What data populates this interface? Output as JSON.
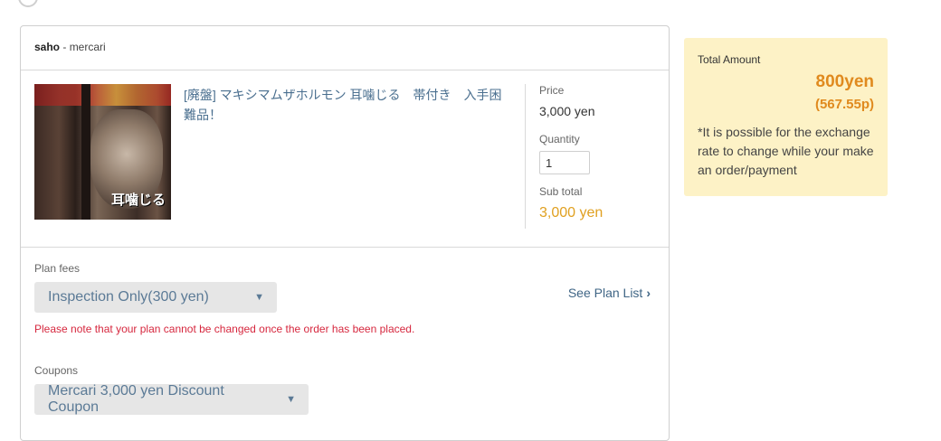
{
  "order": {
    "seller_name": "saho",
    "seller_separator": " - ",
    "seller_platform": "mercari"
  },
  "item": {
    "title": "[廃盤] マキシマムザホルモン 耳噛じる　帯付き　入手困難品！",
    "thumbnail_text": "耳噛じる",
    "price_label": "Price",
    "price_value": "3,000 yen",
    "quantity_label": "Quantity",
    "quantity_value": "1",
    "subtotal_label": "Sub total",
    "subtotal_value": "3,000 yen"
  },
  "plan": {
    "label": "Plan fees",
    "selected": "Inspection Only(300 yen)",
    "see_plan_link": "See Plan List",
    "note": "Please note that your plan cannot be changed once the order has been placed."
  },
  "coupons": {
    "label": "Coupons",
    "selected": "Mercari 3,000 yen Discount Coupon"
  },
  "summary": {
    "total_label": "Total Amount",
    "total_yen": "800yen",
    "total_points": "(567.55p)",
    "note": "*It is possible for the exchange rate to change while your make an order/payment"
  },
  "colors": {
    "accent_orange": "#e08a1e",
    "subtotal_orange": "#e0a020",
    "link_blue": "#3f6585",
    "warning_red": "#d6273e",
    "summary_bg": "#fdf2c6"
  }
}
